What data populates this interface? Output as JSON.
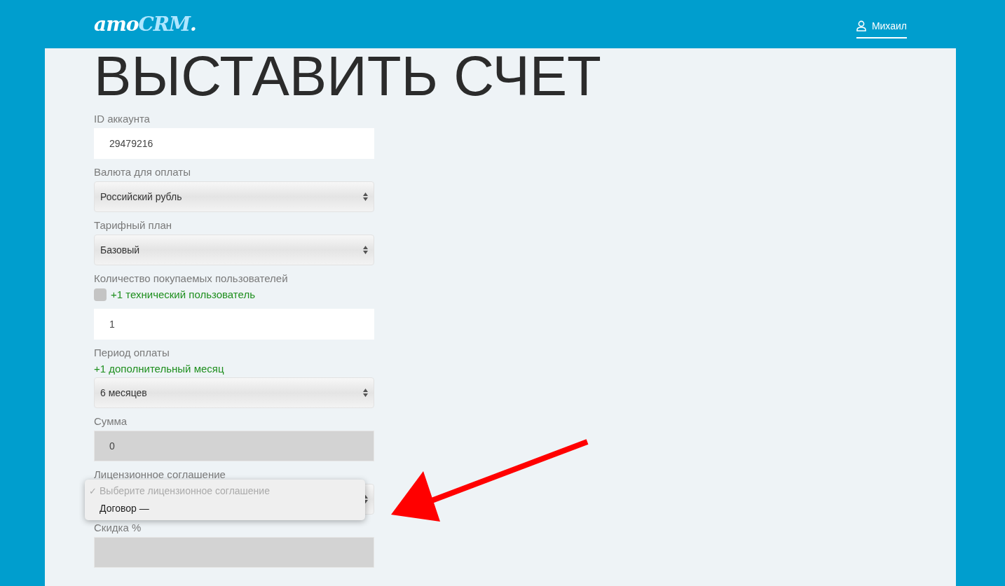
{
  "header": {
    "logo": {
      "main": "amo",
      "accent": "CRM",
      "dot": "."
    },
    "user": {
      "name": "Михаил",
      "selected": true
    }
  },
  "title": "ВЫСТАВИТЬ СЧЕТ",
  "fields": [
    {
      "kind": "input",
      "label": "ID аккаунта",
      "value": "29479216"
    },
    {
      "kind": "select",
      "label": "Валюта для оплаты",
      "value": "Российский рубль"
    },
    {
      "kind": "select",
      "label": "Тарифный план",
      "value": "Базовый"
    },
    {
      "kind": "input",
      "label": "Количество покупаемых пользователей",
      "option": {
        "label": "+1 технический пользователь",
        "checked": false
      },
      "value": "1"
    },
    {
      "kind": "select",
      "label": "Период оплаты",
      "note": "+1 дополнительный месяц",
      "value": "6 месяцев"
    },
    {
      "kind": "readonly",
      "label": "Сумма",
      "value": "0"
    },
    {
      "kind": "select",
      "label": "Лицензионное соглашение",
      "menu": {
        "mark": "✓",
        "options": [
          {
            "label": "Выберите лицензионное соглашение",
            "selected": true,
            "disabled": true
          },
          {
            "label": "Договор —",
            "selected": false,
            "disabled": false
          }
        ]
      }
    },
    {
      "kind": "readonly",
      "label": "Скидка %"
    }
  ]
}
